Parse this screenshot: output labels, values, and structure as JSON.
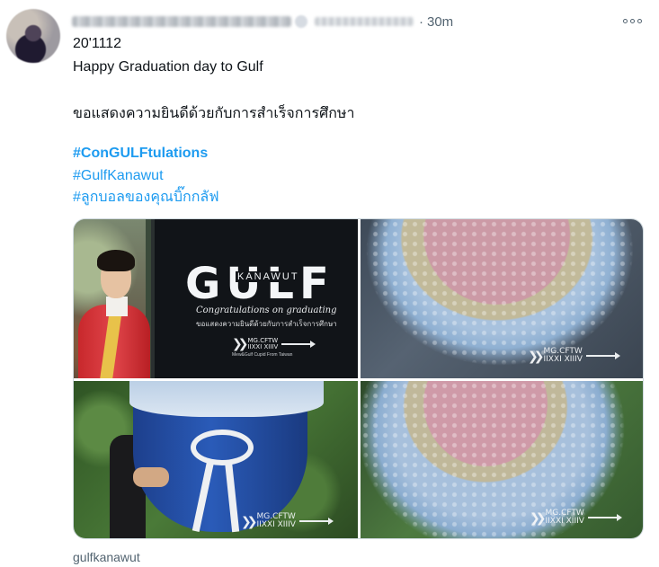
{
  "tweet": {
    "time": "30m",
    "lines": {
      "l1": "20'1112",
      "l2": "Happy Graduation day to Gulf",
      "l3": "ขอแสดงความยินดีด้วยกับการสำเร็จการศึกษา"
    },
    "hashtags": {
      "h1": "#ConGULFtulations",
      "h2": "#GulfKanawut",
      "h3": "#ลูกบอลของคุณบิ๊กกลัฟ"
    },
    "site": "gulfkanawut"
  },
  "media": {
    "photo1": {
      "brand": "GULF",
      "brand_sub": "KANAWUT",
      "congrats": "Congratulations on graduating",
      "thai": "ขอแสดงความยินดีด้วยกับการสำเร็จการศึกษา",
      "watermark_top": "MG.CFTW",
      "watermark_bottom": "IIXXI XIIIV",
      "footer": "Mew&Gulf Cupid From Taiwan"
    },
    "photo2": {
      "watermark_top": "MG.CFTW",
      "watermark_bottom": "IIXXI XIIIV"
    },
    "photo3": {
      "watermark_top": "MG.CFTW",
      "watermark_bottom": "IIXXI XIIIV"
    },
    "photo4": {
      "watermark_top": "MG.CFTW",
      "watermark_bottom": "IIXXI XIIIV"
    }
  },
  "icons": {
    "more": "more-horizontal-icon"
  },
  "colors": {
    "link": "#1d9bf0",
    "secondary": "#536471",
    "text": "#0f1419",
    "border": "#cfd9de"
  }
}
